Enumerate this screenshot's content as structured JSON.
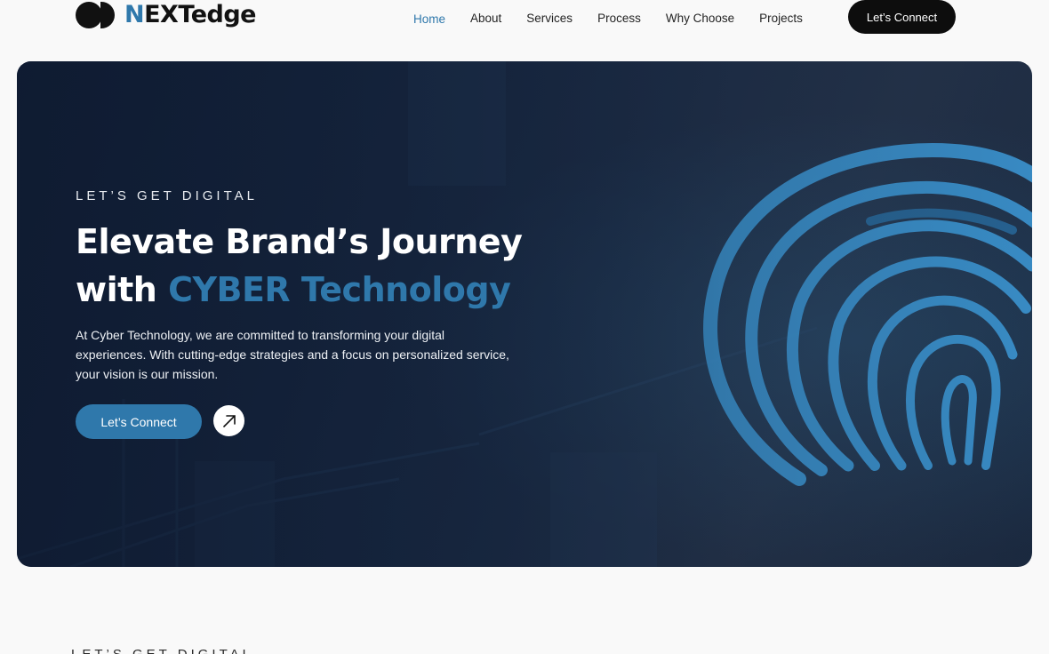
{
  "brand": {
    "accent": "N",
    "rest": "EXTedge",
    "accent_color": "#2f78ab"
  },
  "nav": {
    "items": [
      {
        "label": "Home",
        "active": true
      },
      {
        "label": "About"
      },
      {
        "label": "Services"
      },
      {
        "label": "Process"
      },
      {
        "label": "Why Choose"
      },
      {
        "label": "Projects"
      }
    ],
    "cta_label": "Let’s Connect"
  },
  "hero": {
    "eyebrow": "LET’S GET DIGITAL",
    "headline_line1": "Elevate Brand’s Journey",
    "headline_with": "with ",
    "headline_highlight": "CYBER Technology",
    "description": "At Cyber Technology, we are committed to transforming your digital experiences. With cutting-edge strategies and a focus on personalized service, your vision is our mission.",
    "cta_label": "Let’s Connect",
    "arrow_icon": "arrow-up-right-icon"
  },
  "next_section": {
    "eyebrow": "LET’S GET DIGITAL"
  }
}
